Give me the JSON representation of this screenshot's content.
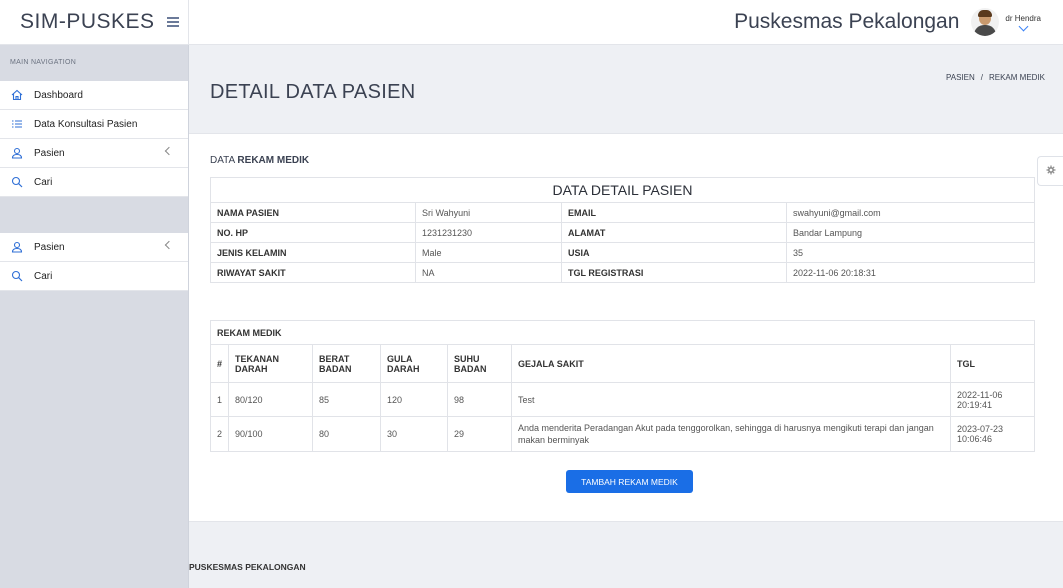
{
  "brand": {
    "title": "SIM-PUSKES"
  },
  "topbar": {
    "site_name": "Puskesmas Pekalongan",
    "user_name": "dr Hendra"
  },
  "sidebar": {
    "header": "MAIN NAVIGATION",
    "items": [
      {
        "label": "Dashboard",
        "icon": "home-icon"
      },
      {
        "label": "Data Konsultasi Pasien",
        "icon": "list-icon"
      },
      {
        "label": "Pasien",
        "icon": "user-icon"
      },
      {
        "label": "Cari",
        "icon": "search-icon"
      }
    ],
    "items2": [
      {
        "label": "Pasien",
        "icon": "user-icon"
      },
      {
        "label": "Cari",
        "icon": "search-icon"
      }
    ]
  },
  "page": {
    "title": "DETAIL DATA PASIEN",
    "breadcrumb": [
      "PASIEN",
      "/",
      "REKAM MEDIK"
    ],
    "section_prefix": "DATA",
    "section_bold": "REKAM MEDIK"
  },
  "detail": {
    "caption": "DATA DETAIL PASIEN",
    "rows": [
      {
        "k1": "NAMA PASIEN",
        "v1": "Sri Wahyuni",
        "k2": "EMAIL",
        "v2": "swahyuni@gmail.com"
      },
      {
        "k1": "NO. HP",
        "v1": "1231231230",
        "k2": "ALAMAT",
        "v2": "Bandar Lampung"
      },
      {
        "k1": "JENIS KELAMIN",
        "v1": "Male",
        "k2": "USIA",
        "v2": "35"
      },
      {
        "k1": "RIWAYAT SAKIT",
        "v1": "NA",
        "k2": "TGL REGISTRASI",
        "v2": "2022-11-06 20:18:31"
      }
    ]
  },
  "rekam": {
    "caption": "REKAM MEDIK",
    "headers": {
      "no": "#",
      "tekanan": [
        "TEKANAN",
        "DARAH"
      ],
      "berat": [
        "BERAT",
        "BADAN"
      ],
      "gula": [
        "GULA",
        "DARAH"
      ],
      "suhu": [
        "SUHU",
        "BADAN"
      ],
      "gejala": "GEJALA SAKIT",
      "tgl": "TGL"
    },
    "rows": [
      {
        "no": "1",
        "tekanan": "80/120",
        "berat": "85",
        "gula": "120",
        "suhu": "98",
        "gejala": "Test",
        "tgl_date": "2022-11-06",
        "tgl_time": "20:19:41"
      },
      {
        "no": "2",
        "tekanan": "90/100",
        "berat": "80",
        "gula": "30",
        "suhu": "29",
        "gejala": "Anda menderita Peradangan Akut pada tenggorolkan, sehingga di harusnya mengikuti terapi dan jangan makan berminyak",
        "tgl_date": "2023-07-23",
        "tgl_time": "10:06:46"
      }
    ]
  },
  "actions": {
    "add_label": "TAMBAH REKAM MEDIK"
  },
  "footer": {
    "text": "PUSKESMAS PEKALONGAN"
  },
  "colors": {
    "primary": "#1a6ee6",
    "sidebar_bg": "#d8dbe3",
    "icon_blue": "#2f6fd6"
  }
}
